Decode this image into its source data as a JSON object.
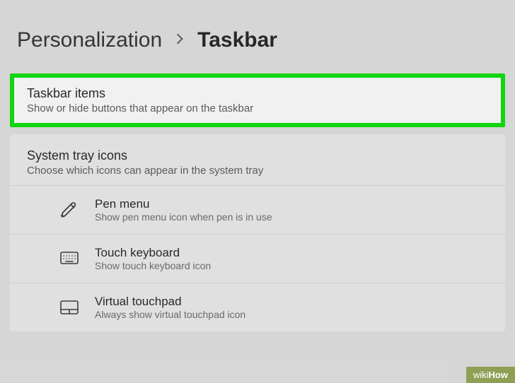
{
  "breadcrumb": {
    "parent": "Personalization",
    "current": "Taskbar"
  },
  "cards": {
    "taskbar_items": {
      "title": "Taskbar items",
      "subtitle": "Show or hide buttons that appear on the taskbar"
    },
    "system_tray": {
      "title": "System tray icons",
      "subtitle": "Choose which icons can appear in the system tray",
      "rows": [
        {
          "title": "Pen menu",
          "subtitle": "Show pen menu icon when pen is in use"
        },
        {
          "title": "Touch keyboard",
          "subtitle": "Show touch keyboard icon"
        },
        {
          "title": "Virtual touchpad",
          "subtitle": "Always show virtual touchpad icon"
        }
      ]
    }
  },
  "watermark": {
    "prefix": "wiki",
    "suffix": "How"
  }
}
